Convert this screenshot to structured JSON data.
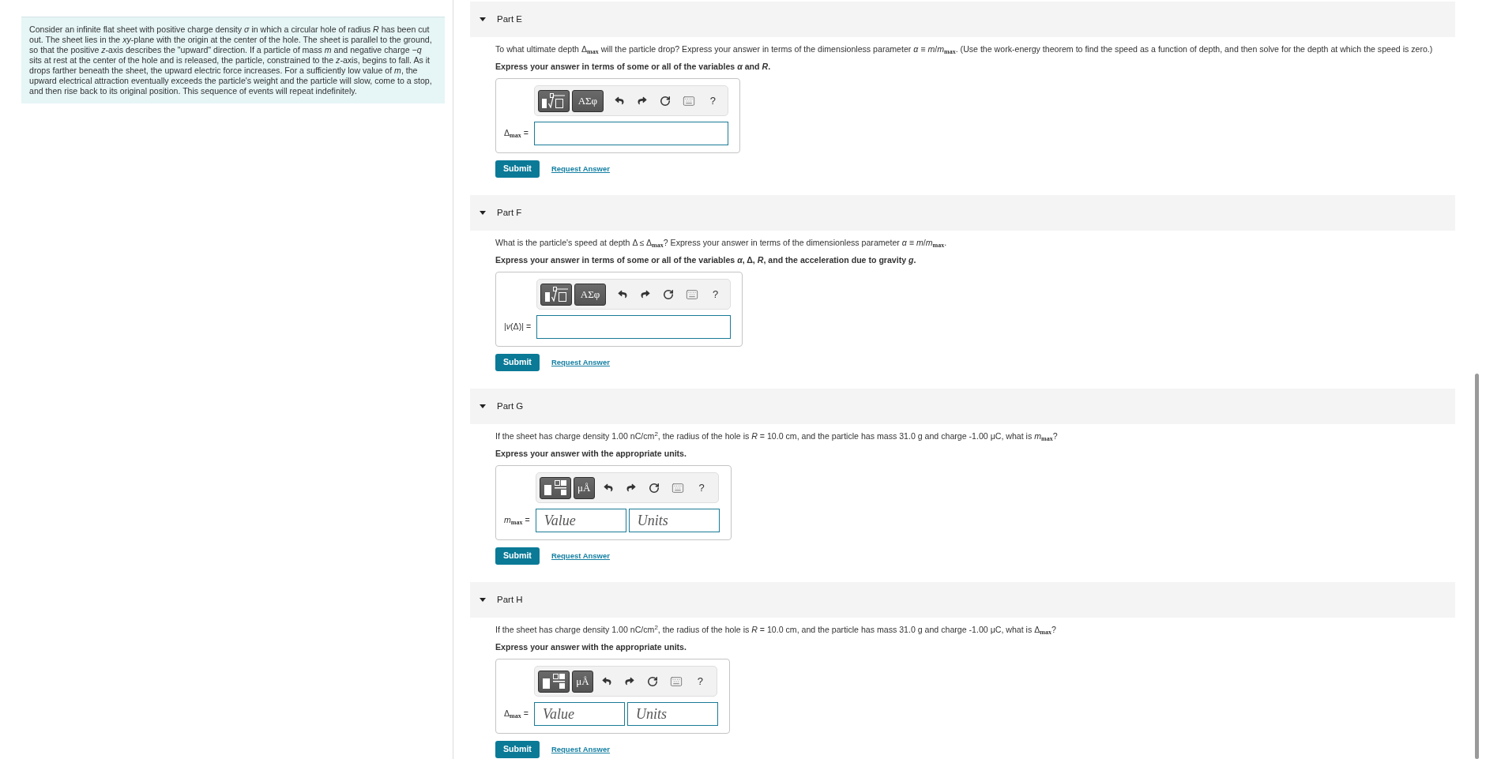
{
  "intro": {
    "text": "Consider an infinite flat sheet with positive charge density *σ* in which a circular hole of radius *R* has been cut out. The sheet lies in the *xy*-plane with the origin at the center of the hole. The sheet is parallel to the ground, so that the positive *z*-axis describes the \"upward\" direction. If a particle of mass *m* and negative charge −*q* sits at rest at the center of the hole and is released, the particle, constrained to the *z*-axis, begins to fall. As it drops farther beneath the sheet, the upward electric force increases. For a sufficiently low value of *m*, the upward electrical attraction eventually exceeds the particle's weight and the particle will slow, come to a stop, and then rise back to its original position. This sequence of events will repeat indefinitely."
  },
  "parts": [
    {
      "title": "Part E",
      "expanded": true,
      "question": "To what ultimate depth Δ$_{max}$ will the particle drop? Express your answer in terms of the dimensionless parameter *α* ≡ *m*/*m*$_{max}$. (Use the work-energy theorem to find the speed as a function of depth, and then solve for the depth at which the speed is zero.)",
      "instruction": "Express your answer in terms of some or all of the variables *α* and *R*.",
      "answer": {
        "kind": "expression",
        "symbols_label": "ΑΣφ",
        "help_label": "?",
        "label": "Δ$_{max}$ ="
      },
      "submit_label": "Submit",
      "request_label": "Request Answer"
    },
    {
      "title": "Part F",
      "expanded": true,
      "question": "What is the particle's speed at depth Δ ≤ Δ$_{max}$? Express your answer in terms of the dimensionless parameter *α* ≡ *m*/*m*$_{max}$.",
      "instruction": "Express your answer in terms of some or all of the variables *α*, Δ, *R*, and the acceleration due to gravity *g*.",
      "answer": {
        "kind": "expression",
        "symbols_label": "ΑΣφ",
        "help_label": "?",
        "label": "|*v*(Δ)| ="
      },
      "submit_label": "Submit",
      "request_label": "Request Answer"
    },
    {
      "title": "Part G",
      "expanded": true,
      "question": "If the sheet has charge density 1.00 nC/cm$^{2}$, the radius of the hole is *R* = 10.0 cm, and the particle has mass 31.0 g and charge -1.00 μC, what is *m*$_{max}$?",
      "instruction": "Express your answer with the appropriate units.",
      "answer": {
        "kind": "units",
        "symbols_label": "μÅ",
        "help_label": "?",
        "label": "*m*$_{max}$ =",
        "value_placeholder": "Value",
        "units_placeholder": "Units"
      },
      "submit_label": "Submit",
      "request_label": "Request Answer"
    },
    {
      "title": "Part H",
      "expanded": true,
      "question": "If the sheet has charge density 1.00 nC/cm$^{2}$, the radius of the hole is *R* = 10.0 cm, and the particle has mass 31.0 g and charge -1.00 μC, what is Δ$_{max}$?",
      "instruction": "Express your answer with the appropriate units.",
      "answer": {
        "kind": "units",
        "symbols_label": "μÅ",
        "help_label": "?",
        "label": "Δ$_{max}$ =",
        "value_placeholder": "Value",
        "units_placeholder": "Units"
      },
      "submit_label": "Submit",
      "request_label": "Request Answer"
    }
  ]
}
